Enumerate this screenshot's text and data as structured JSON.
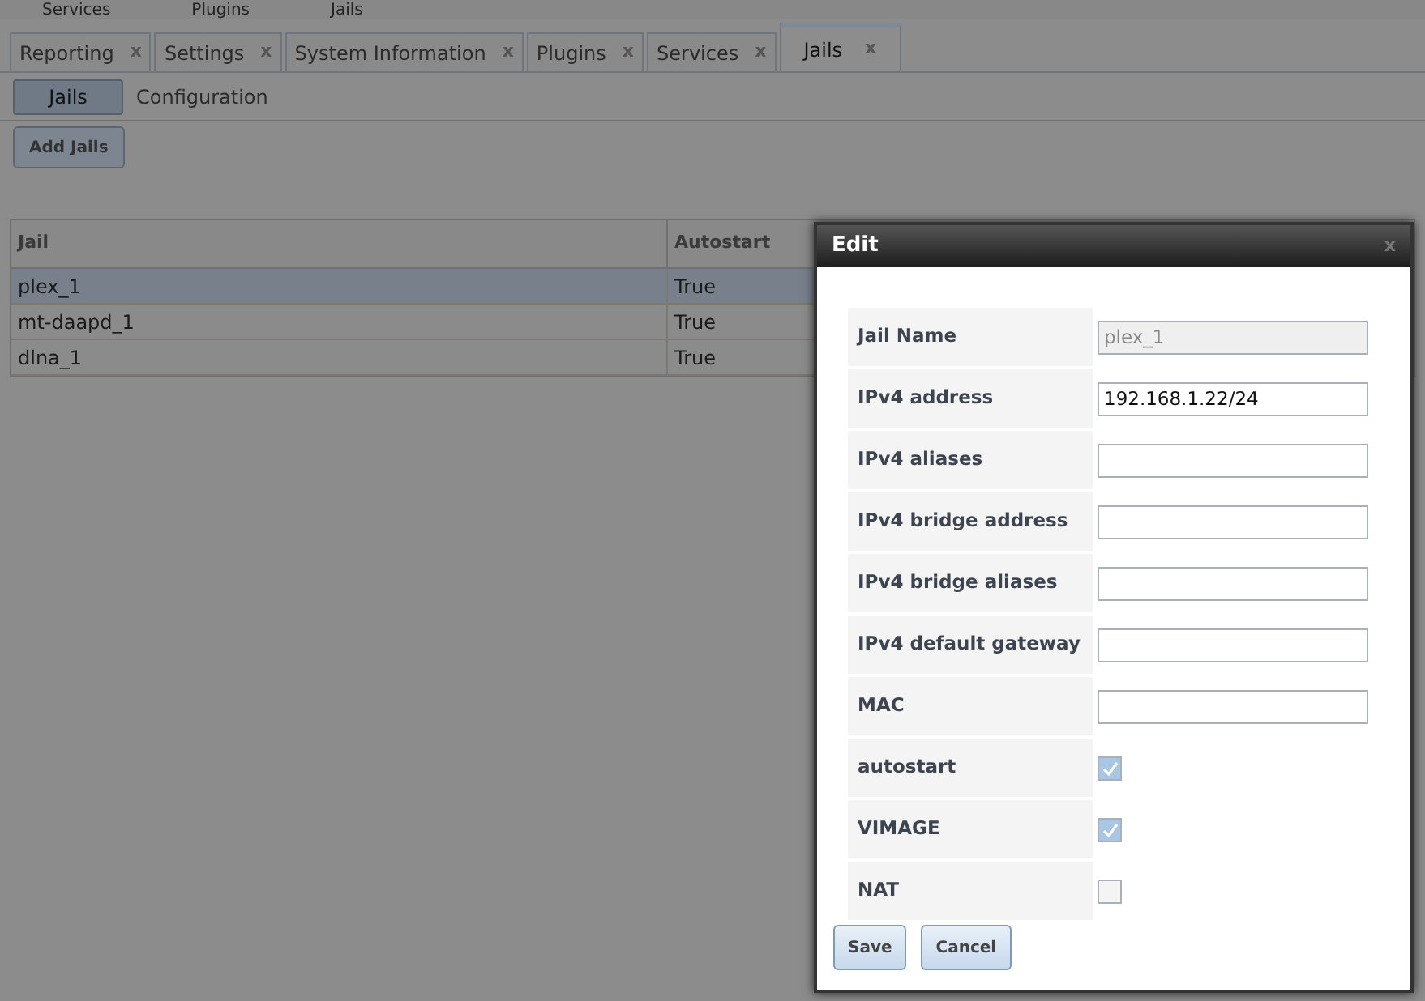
{
  "top_menu": [
    "Services",
    "Plugins",
    "Jails"
  ],
  "tabs": [
    {
      "label": "Reporting",
      "close": "x",
      "selected": false
    },
    {
      "label": "Settings",
      "close": "x",
      "selected": false
    },
    {
      "label": "System Information",
      "close": "x",
      "selected": false
    },
    {
      "label": "Plugins",
      "close": "x",
      "selected": false
    },
    {
      "label": "Services",
      "close": "x",
      "selected": false
    },
    {
      "label": "Jails",
      "close": "x",
      "selected": true
    }
  ],
  "subtabs": [
    {
      "label": "Jails",
      "selected": true
    },
    {
      "label": "Configuration",
      "selected": false
    }
  ],
  "add_button": "Add Jails",
  "table": {
    "columns": [
      "Jail",
      "Autostart"
    ],
    "rows": [
      {
        "cells": [
          "plex_1",
          "True"
        ],
        "selected": true
      },
      {
        "cells": [
          "mt-daapd_1",
          "True"
        ],
        "selected": false
      },
      {
        "cells": [
          "dlna_1",
          "True"
        ],
        "selected": false
      }
    ]
  },
  "dialog": {
    "title": "Edit",
    "close_glyph": "x",
    "fields": [
      {
        "kind": "text",
        "label": "Jail Name",
        "value": "plex_1",
        "disabled": true
      },
      {
        "kind": "text",
        "label": "IPv4 address",
        "value": "192.168.1.22/24",
        "disabled": false
      },
      {
        "kind": "text",
        "label": "IPv4 aliases",
        "disabled": false
      },
      {
        "kind": "text",
        "label": "IPv4 bridge address",
        "disabled": false
      },
      {
        "kind": "text",
        "label": "IPv4 bridge aliases",
        "disabled": false
      },
      {
        "kind": "text",
        "label": "IPv4 default gateway",
        "disabled": false
      },
      {
        "kind": "text",
        "label": "MAC",
        "disabled": false
      },
      {
        "kind": "checkbox",
        "label": "autostart",
        "checked": true
      },
      {
        "kind": "checkbox",
        "label": "VIMAGE",
        "checked": true
      },
      {
        "kind": "checkbox",
        "label": "NAT",
        "checked": false
      }
    ],
    "buttons": [
      "Save",
      "Cancel"
    ]
  }
}
